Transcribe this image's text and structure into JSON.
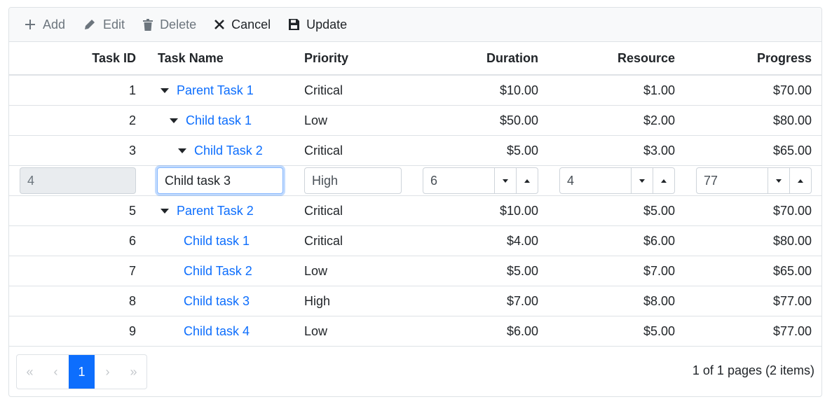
{
  "toolbar": {
    "add": "Add",
    "edit": "Edit",
    "delete": "Delete",
    "cancel": "Cancel",
    "update": "Update"
  },
  "columns": {
    "id": "Task ID",
    "name": "Task Name",
    "priority": "Priority",
    "duration": "Duration",
    "resource": "Resource",
    "progress": "Progress"
  },
  "rows": [
    {
      "id": "1",
      "name": "Parent Task 1",
      "priority": "Critical",
      "duration": "$10.00",
      "resource": "$1.00",
      "progress": "$70.00"
    },
    {
      "id": "2",
      "name": "Child task 1",
      "priority": "Low",
      "duration": "$50.00",
      "resource": "$2.00",
      "progress": "$80.00"
    },
    {
      "id": "3",
      "name": "Child Task 2",
      "priority": "Critical",
      "duration": "$5.00",
      "resource": "$3.00",
      "progress": "$65.00"
    },
    {
      "id": "5",
      "name": "Parent Task 2",
      "priority": "Critical",
      "duration": "$10.00",
      "resource": "$5.00",
      "progress": "$70.00"
    },
    {
      "id": "6",
      "name": "Child task 1",
      "priority": "Critical",
      "duration": "$4.00",
      "resource": "$6.00",
      "progress": "$80.00"
    },
    {
      "id": "7",
      "name": "Child Task 2",
      "priority": "Low",
      "duration": "$5.00",
      "resource": "$7.00",
      "progress": "$65.00"
    },
    {
      "id": "8",
      "name": "Child task 3",
      "priority": "High",
      "duration": "$7.00",
      "resource": "$8.00",
      "progress": "$77.00"
    },
    {
      "id": "9",
      "name": "Child task 4",
      "priority": "Low",
      "duration": "$6.00",
      "resource": "$5.00",
      "progress": "$77.00"
    }
  ],
  "edit_row": {
    "id": "4",
    "name": "Child task 3",
    "priority": "High",
    "duration": "6",
    "resource": "4",
    "progress": "77"
  },
  "pager": {
    "current_page": "1",
    "first": "«",
    "prev": "‹",
    "next": "›",
    "last": "»",
    "info": "1 of 1 pages (2 items)"
  },
  "colors": {
    "link": "#0d6efd",
    "active_page": "#0d6efd",
    "toolbar_bg": "#f8f9fa"
  }
}
